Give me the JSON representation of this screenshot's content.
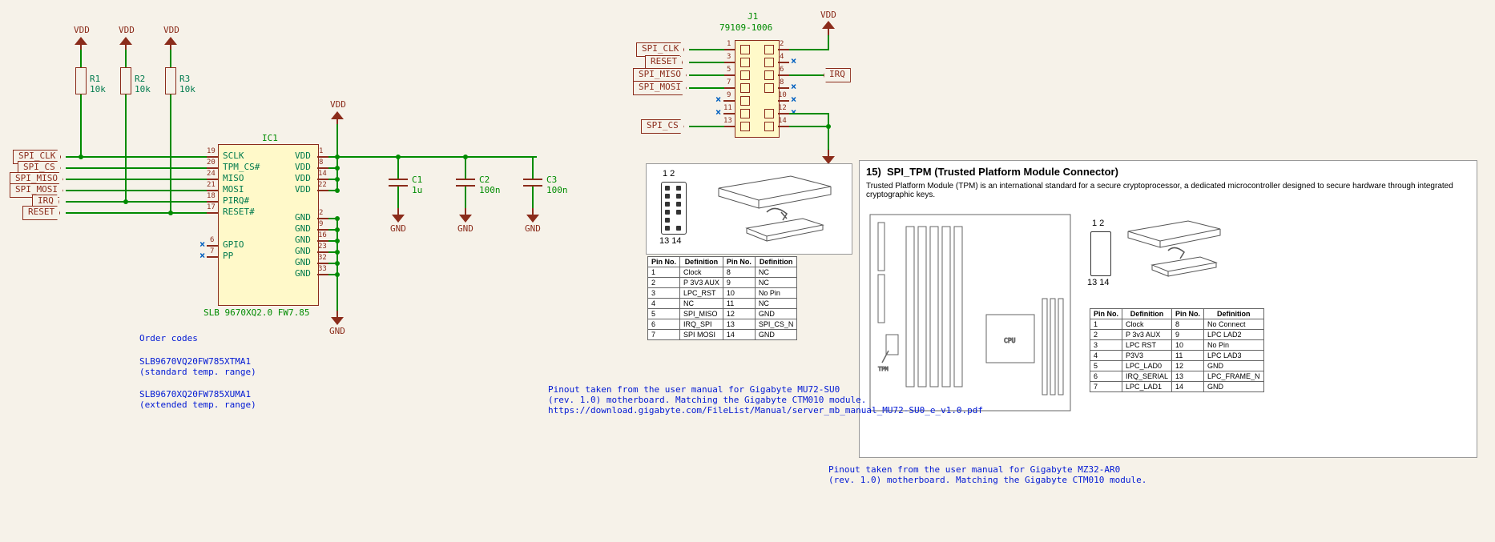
{
  "power": {
    "vdd": "VDD",
    "gnd": "GND"
  },
  "resistors": {
    "r1": {
      "ref": "R1",
      "val": "10k"
    },
    "r2": {
      "ref": "R2",
      "val": "10k"
    },
    "r3": {
      "ref": "R3",
      "val": "10k"
    }
  },
  "caps": {
    "c1": {
      "ref": "C1",
      "val": "1u"
    },
    "c2": {
      "ref": "C2",
      "val": "100n"
    },
    "c3": {
      "ref": "C3",
      "val": "100n"
    }
  },
  "ic1": {
    "ref": "IC1",
    "value": "SLB 9670XQ2.0 FW7.85",
    "pins_left": [
      {
        "num": "19",
        "name": "SCLK"
      },
      {
        "num": "20",
        "name": "TPM_CS#"
      },
      {
        "num": "24",
        "name": "MISO"
      },
      {
        "num": "21",
        "name": "MOSI"
      },
      {
        "num": "18",
        "name": "PIRQ#"
      },
      {
        "num": "17",
        "name": "RESET#"
      },
      {
        "num": "6",
        "name": "GPIO"
      },
      {
        "num": "7",
        "name": "PP"
      }
    ],
    "pins_right": [
      {
        "num": "1",
        "name": "VDD"
      },
      {
        "num": "8",
        "name": "VDD"
      },
      {
        "num": "14",
        "name": "VDD"
      },
      {
        "num": "22",
        "name": "VDD"
      },
      {
        "num": "2",
        "name": "GND"
      },
      {
        "num": "9",
        "name": "GND"
      },
      {
        "num": "16",
        "name": "GND"
      },
      {
        "num": "23",
        "name": "GND"
      },
      {
        "num": "32",
        "name": "GND"
      },
      {
        "num": "33",
        "name": "GND"
      }
    ]
  },
  "j1": {
    "ref": "J1",
    "value": "79109-1006",
    "pins_left": [
      "1",
      "3",
      "5",
      "7",
      "9",
      "11",
      "13"
    ],
    "pins_right": [
      "2",
      "4",
      "6",
      "8",
      "10",
      "12",
      "14"
    ]
  },
  "nets": {
    "spi_clk": "SPI_CLK",
    "spi_cs": "SPI_CS",
    "spi_miso": "SPI_MISO",
    "spi_mosi": "SPI_MOSI",
    "irq": "IRQ",
    "reset": "RESET"
  },
  "notes": {
    "order_title": "Order codes",
    "order1a": "SLB9670VQ20FW785XTMA1",
    "order1b": "(standard temp. range)",
    "order2a": "SLB9670XQ20FW785XUMA1",
    "order2b": "(extended temp. range)",
    "pinout_note1": "Pinout taken from the user manual for Gigabyte MU72-SU0\n(rev. 1.0) motherboard. Matching the Gigabyte CTM010 module.\nhttps://download.gigabyte.com/FileList/Manual/server_mb_manual_MU72-SU0_e_v1.0.pdf",
    "pinout_note2": "Pinout taken from the user manual for Gigabyte MZ32-AR0\n(rev. 1.0) motherboard. Matching the Gigabyte CTM010 module."
  },
  "datasheet": {
    "title": "15)  SPI_TPM (Trusted Platform Module Connector)",
    "body": "Trusted Platform Module (TPM) is an international standard for a secure cryptoprocessor, a dedicated microcontroller designed to secure hardware through integrated cryptographic keys.",
    "conn_labels": {
      "top": "1 2",
      "bot": "13 14"
    },
    "table1": {
      "hdr": [
        "Pin No.",
        "Definition",
        "Pin No.",
        "Definition"
      ],
      "rows": [
        [
          "1",
          "Clock",
          "8",
          "NC"
        ],
        [
          "2",
          "P 3V3 AUX",
          "9",
          "NC"
        ],
        [
          "3",
          "LPC_RST",
          "10",
          "No Pin"
        ],
        [
          "4",
          "NC",
          "11",
          "NC"
        ],
        [
          "5",
          "SPI_MISO",
          "12",
          "GND"
        ],
        [
          "6",
          "IRQ_SPI",
          "13",
          "SPI_CS_N"
        ],
        [
          "7",
          "SPI MOSI",
          "14",
          "GND"
        ]
      ]
    },
    "table2": {
      "hdr": [
        "Pin No.",
        "Definition",
        "Pin No.",
        "Definition"
      ],
      "rows": [
        [
          "1",
          "Clock",
          "8",
          "No Connect"
        ],
        [
          "2",
          "P 3v3 AUX",
          "9",
          "LPC LAD2"
        ],
        [
          "3",
          "LPC RST",
          "10",
          "No Pin"
        ],
        [
          "4",
          "P3V3",
          "11",
          "LPC LAD3"
        ],
        [
          "5",
          "LPC_LAD0",
          "12",
          "GND"
        ],
        [
          "6",
          "IRQ_SERIAL",
          "13",
          "LPC_FRAME_N"
        ],
        [
          "7",
          "LPC_LAD1",
          "14",
          "GND"
        ]
      ]
    }
  }
}
